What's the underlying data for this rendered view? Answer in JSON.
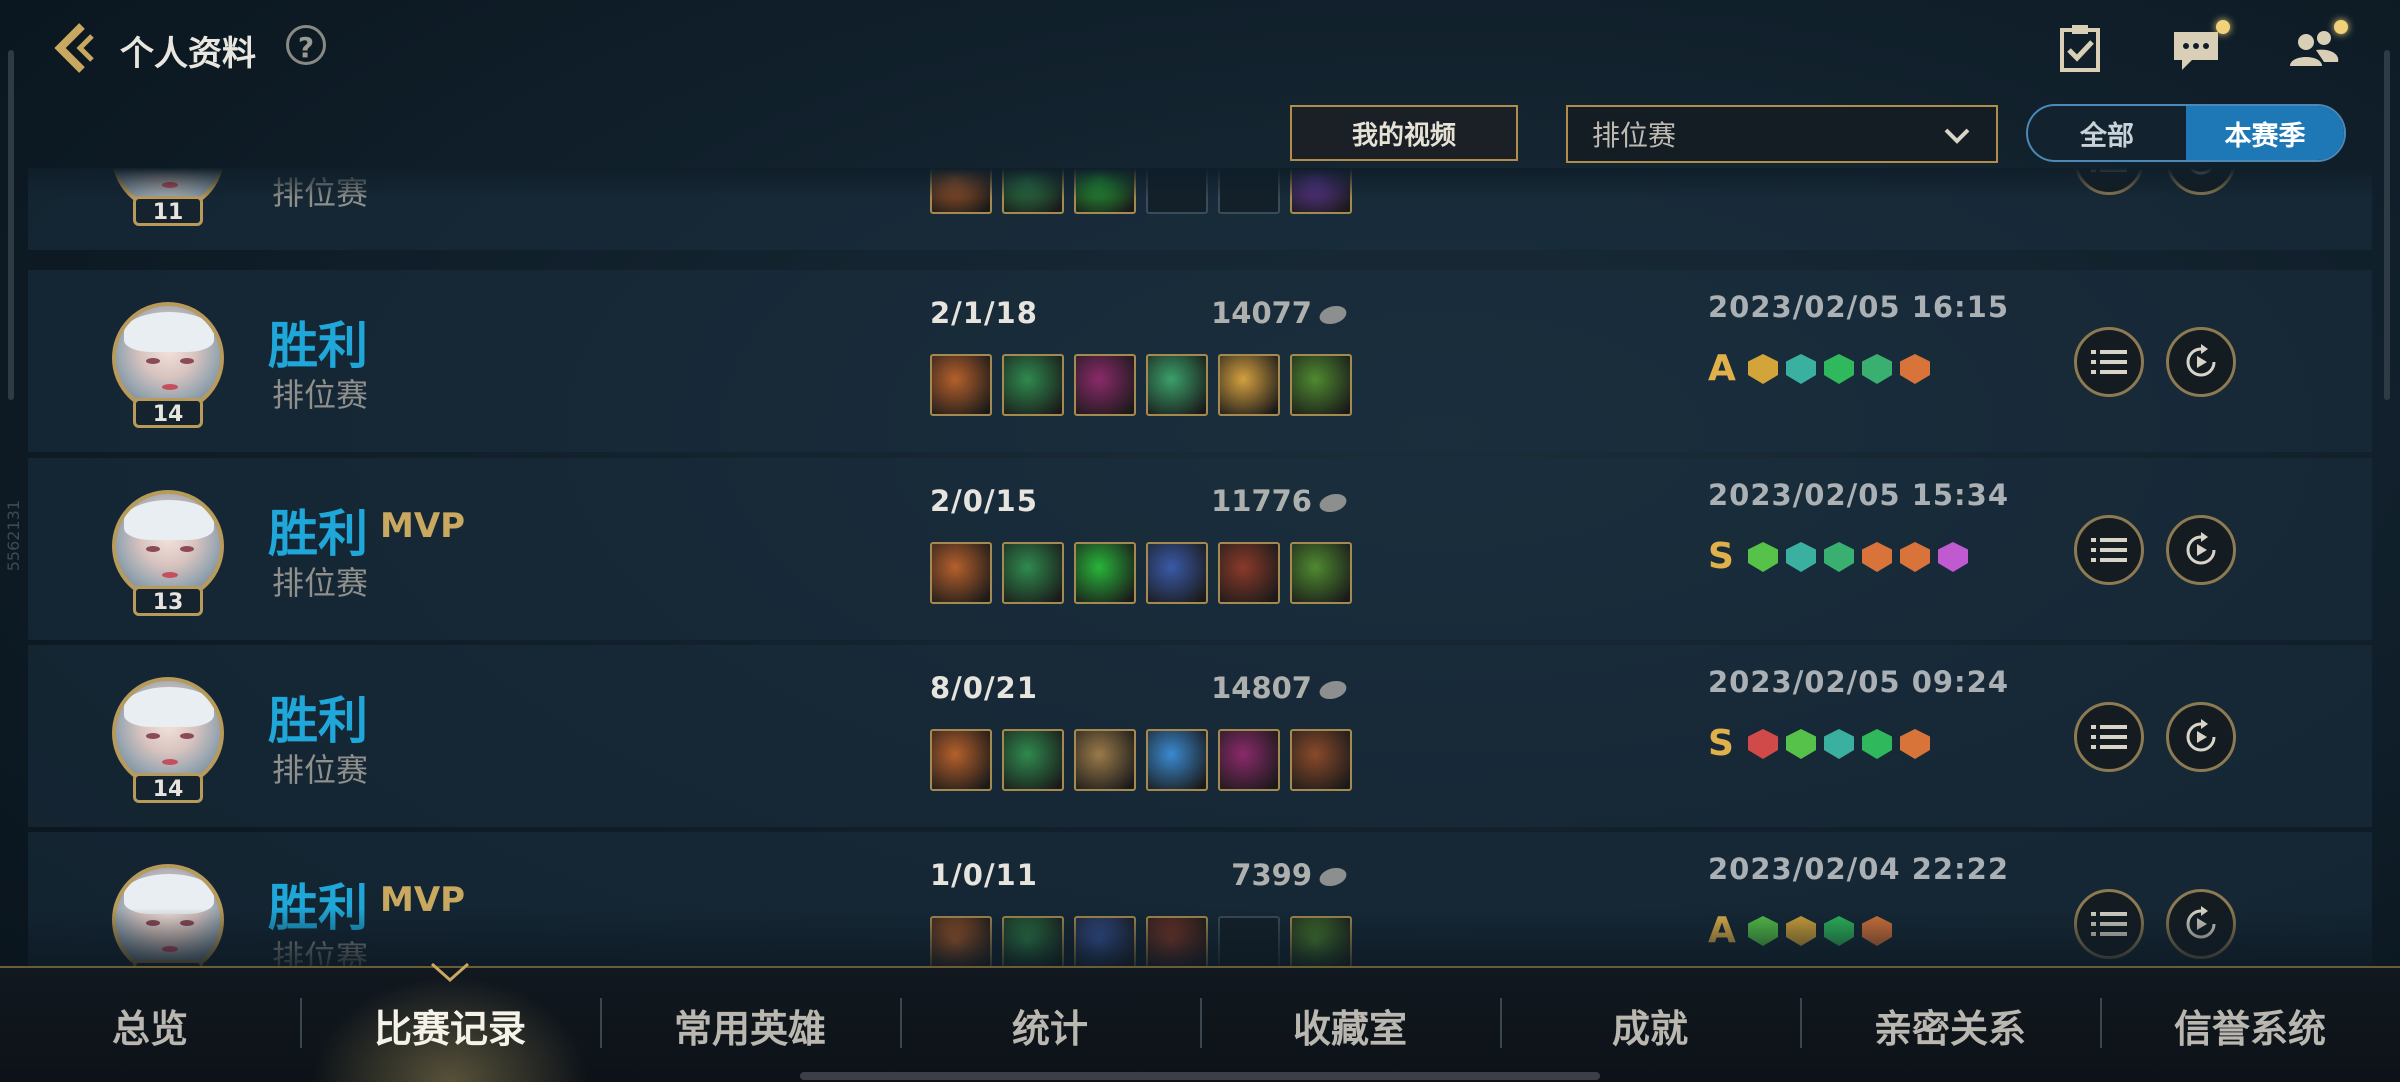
{
  "header": {
    "title": "个人资料",
    "help_label": "?"
  },
  "filters": {
    "my_videos": "我的视频",
    "queue_selected": "排位赛",
    "season_all": "全部",
    "season_current": "本赛季"
  },
  "watermark": "5562131",
  "matches": [
    {
      "result": "",
      "mvp": "",
      "mode": "排位赛",
      "level": "11",
      "kda": "",
      "gold": "",
      "date": "",
      "grade": "",
      "items": [
        "#b5602c",
        "#2f8a4e",
        "#28b43a",
        "empty",
        "empty",
        "#6a3aa8"
      ],
      "tags": [
        "#2fb85c",
        "#d8743a",
        "#d8743a",
        "#b7d64a"
      ]
    },
    {
      "result": "胜利",
      "mvp": "",
      "mode": "排位赛",
      "level": "14",
      "kda": "2/1/18",
      "gold": "14077",
      "date": "2023/02/05 16:15",
      "grade": "A",
      "items": [
        "#b5602c",
        "#2f8a4e",
        "#8a2a6a",
        "#3aa06a",
        "#d4a040",
        "#4f8a30"
      ],
      "tags": [
        "#d2a43a",
        "#3ab0a0",
        "#2fb85c",
        "#3ab070",
        "#d8743a"
      ]
    },
    {
      "result": "胜利",
      "mvp": "MVP",
      "mode": "排位赛",
      "level": "13",
      "kda": "2/0/15",
      "gold": "11776",
      "date": "2023/02/05 15:34",
      "grade": "S",
      "items": [
        "#b5602c",
        "#2f8a4e",
        "#28b43a",
        "#3a5aa8",
        "#8a3a2a",
        "#4f8a30"
      ],
      "tags": [
        "#56c24a",
        "#3ab0a0",
        "#3ab070",
        "#d8743a",
        "#d8743a",
        "#c05ad0"
      ]
    },
    {
      "result": "胜利",
      "mvp": "",
      "mode": "排位赛",
      "level": "14",
      "kda": "8/0/21",
      "gold": "14807",
      "date": "2023/02/05 09:24",
      "grade": "S",
      "items": [
        "#b5602c",
        "#2f8a4e",
        "#9a7a4a",
        "#3a8ad0",
        "#8a2a6a",
        "#8a4a2a"
      ],
      "tags": [
        "#d04a4a",
        "#56c24a",
        "#3ab0a0",
        "#2fb85c",
        "#d8743a"
      ]
    },
    {
      "result": "胜利",
      "mvp": "MVP",
      "mode": "排位赛",
      "level": "",
      "kda": "1/0/11",
      "gold": "7399",
      "date": "2023/02/04 22:22",
      "grade": "A",
      "items": [
        "#b5602c",
        "#2f8a4e",
        "#3a5aa8",
        "#8a3a2a",
        "empty",
        "#4f8a30"
      ],
      "tags": [
        "#56c24a",
        "#d2a43a",
        "#2fb85c",
        "#d8743a"
      ]
    }
  ],
  "tabs": [
    "总览",
    "比赛记录",
    "常用英雄",
    "统计",
    "收藏室",
    "成就",
    "亲密关系",
    "信誉系统"
  ],
  "active_tab": "比赛记录",
  "icons": {
    "back": "back-chevron-icon",
    "missions": "clipboard-check-icon",
    "chat": "chat-icon",
    "friends": "friends-icon",
    "stats": "list-icon",
    "replay": "replay-icon"
  }
}
